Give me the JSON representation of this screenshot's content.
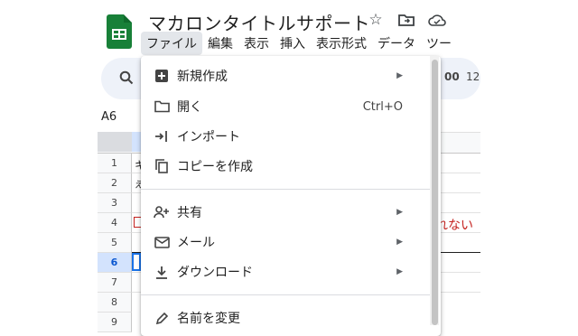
{
  "header": {
    "doc_title": "マカロンタイトルサポート",
    "icons": [
      "star-icon",
      "move-to-folder-icon",
      "cloud-status-icon"
    ]
  },
  "menubar": {
    "items": [
      "ファイル",
      "編集",
      "表示",
      "挿入",
      "表示形式",
      "データ",
      "ツー"
    ]
  },
  "toolbar": {
    "zoom_fragment": "00",
    "font_size_fragment": "12"
  },
  "namebox": {
    "value": "A6"
  },
  "grid": {
    "rows": [
      "1",
      "2",
      "3",
      "4",
      "5",
      "6",
      "7",
      "8",
      "9"
    ],
    "selected_row": "6",
    "cell_fragments": {
      "r1": "キ",
      "r2": "え",
      "r4_right": "れない"
    }
  },
  "file_menu": {
    "items": [
      {
        "label": "新規作成",
        "icon": "new-icon",
        "submenu": true
      },
      {
        "label": "開く",
        "icon": "folder-icon",
        "shortcut": "Ctrl+O"
      },
      {
        "label": "インポート",
        "icon": "import-icon"
      },
      {
        "label": "コピーを作成",
        "icon": "copy-icon"
      },
      {
        "label": "共有",
        "icon": "person-add-icon",
        "submenu": true
      },
      {
        "label": "メール",
        "icon": "mail-icon",
        "submenu": true
      },
      {
        "label": "ダウンロード",
        "icon": "download-icon",
        "submenu": true
      },
      {
        "label": "名前を変更",
        "icon": "pencil-icon"
      }
    ]
  },
  "colors": {
    "brand_green": "#188038",
    "selection_blue": "#d3e3fd",
    "menu_active_bg": "#e3e6ea",
    "error_red": "#c5221f"
  }
}
